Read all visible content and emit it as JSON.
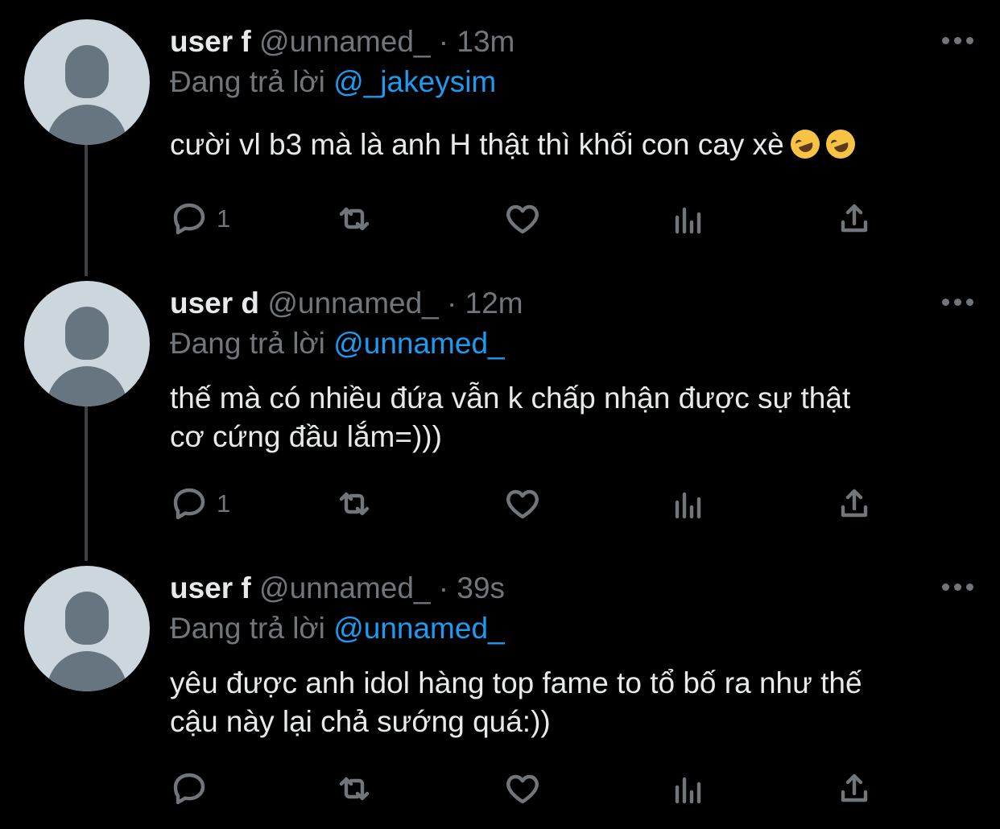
{
  "tweets": [
    {
      "name": "user f",
      "handle": "@unnamed_",
      "separator": "·",
      "time": "13m",
      "reply_prefix": "Đang trả lời",
      "reply_to": "@_jakeysim",
      "text_lines": [
        "cười vl b3 mà là anh H thật thì khối con cay xè"
      ],
      "emojis": [
        "rolling-on-floor-laughing",
        "rolling-on-floor-laughing"
      ],
      "reply_count": "1"
    },
    {
      "name": "user d",
      "handle": "@unnamed_",
      "separator": "·",
      "time": "12m",
      "reply_prefix": "Đang trả lời",
      "reply_to": "@unnamed_",
      "text_lines": [
        "thế mà có nhiều đứa vẫn k chấp nhận được sự thật",
        "cơ cứng đầu lắm=)))"
      ],
      "reply_count": "1"
    },
    {
      "name": "user f",
      "handle": "@unnamed_",
      "separator": "·",
      "time": "39s",
      "reply_prefix": "Đang trả lời",
      "reply_to": "@unnamed_",
      "text_lines": [
        "yêu được anh idol hàng top fame to tổ bố ra như thế",
        "cậu này lại chả sướng quá:))"
      ],
      "reply_count": ""
    }
  ],
  "colors": {
    "background": "#000000",
    "text_primary": "#e7e9ea",
    "text_secondary": "#71767b",
    "link": "#1d9bf0",
    "avatar_bg": "#ccd6dd",
    "avatar_fg": "#66757f",
    "thread_line": "#3e4144"
  },
  "icons": {
    "more": "more-horizontal-icon",
    "reply": "reply-bubble-icon",
    "retweet": "retweet-icon",
    "like": "heart-icon",
    "views": "bar-chart-icon",
    "share": "share-upload-icon"
  }
}
